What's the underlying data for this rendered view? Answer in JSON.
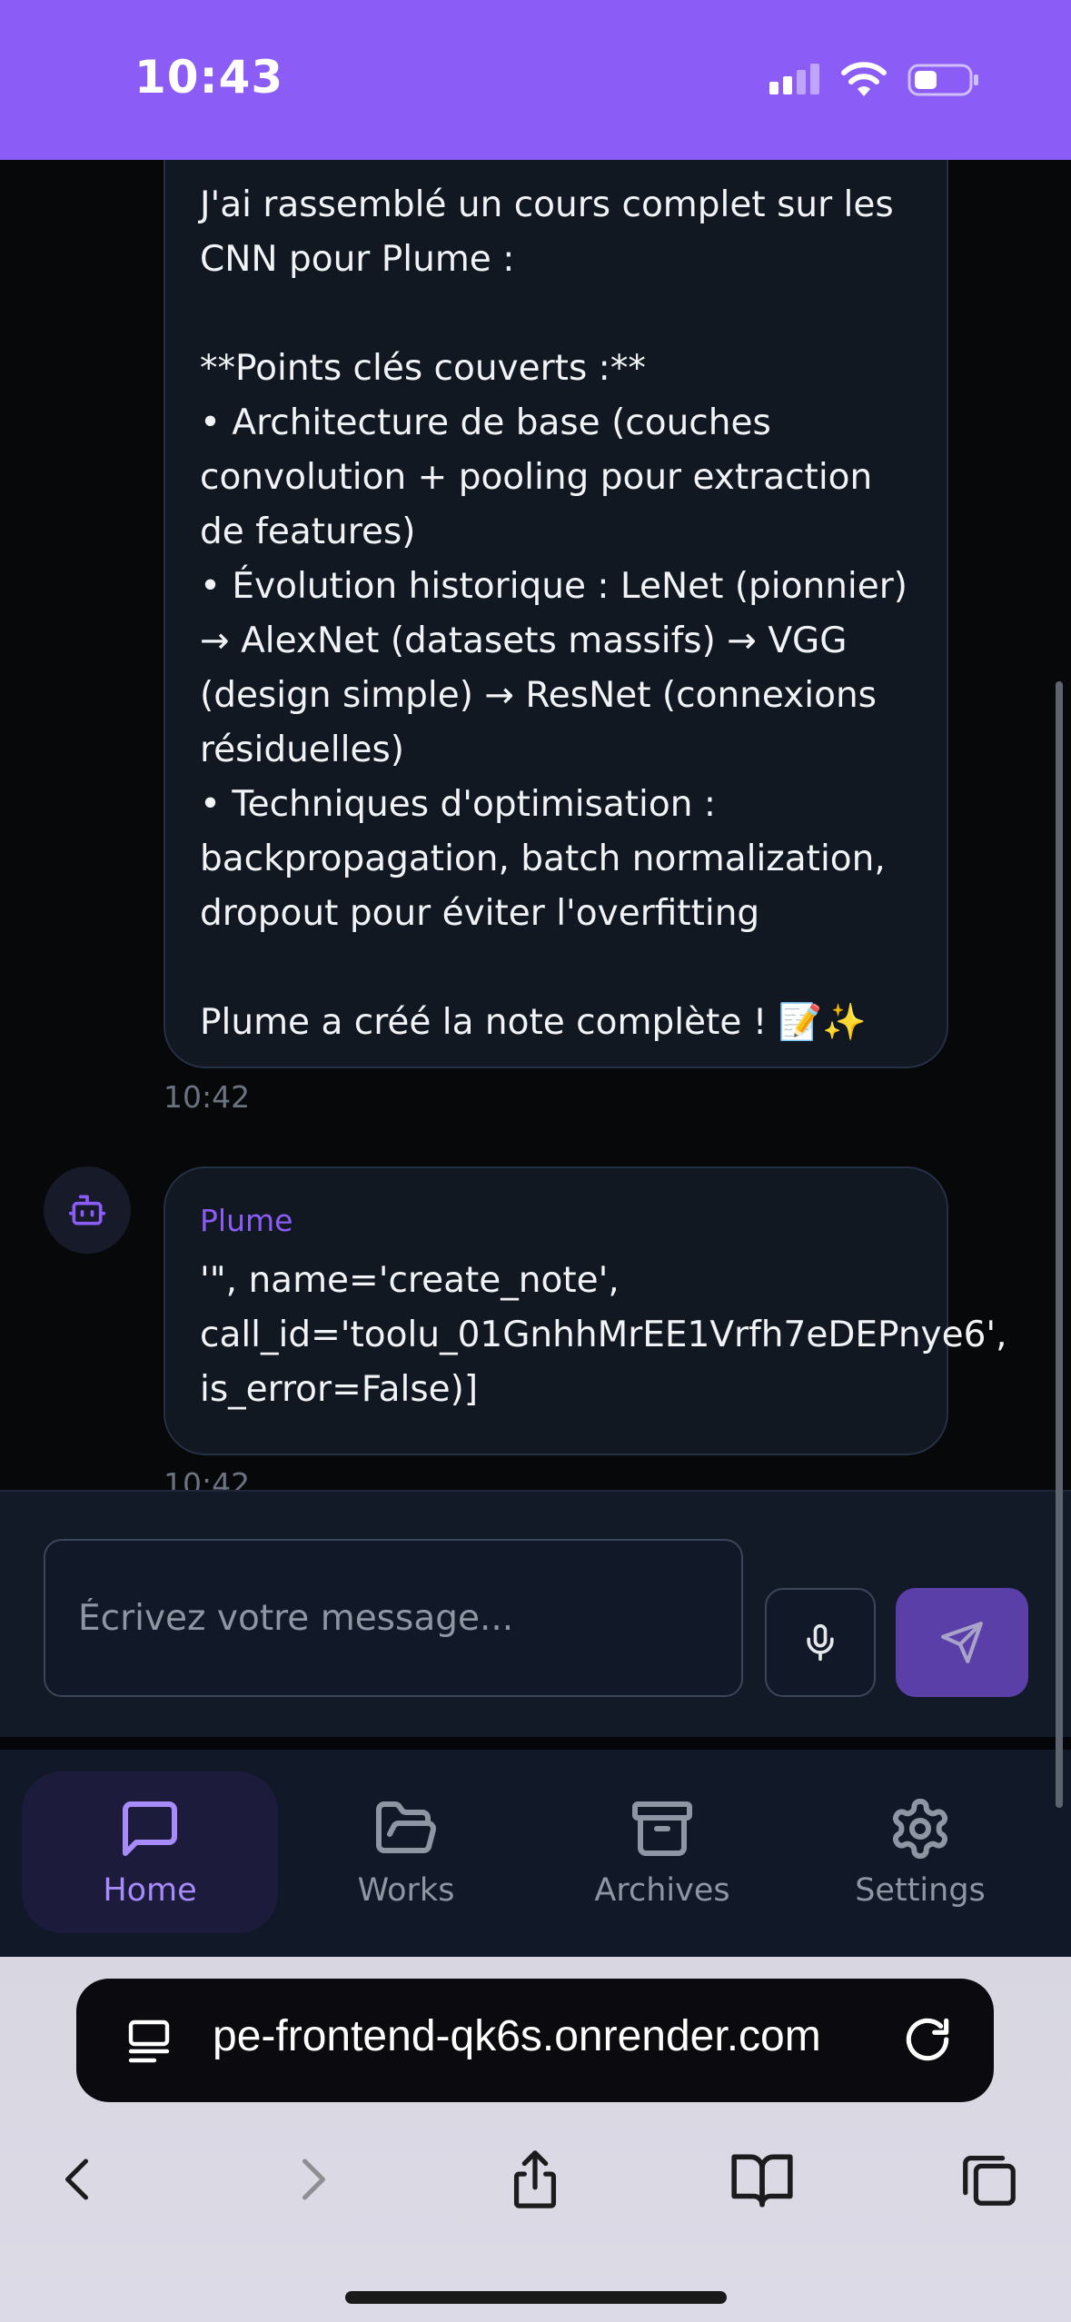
{
  "status_bar": {
    "time": "10:43"
  },
  "chat": {
    "messages": [
      {
        "text": "J'ai rassemblé un cours complet sur les\nCNN pour Plume :\n\n**Points clés couverts :**\n• Architecture de base (couches\nconvolution + pooling pour extraction\nde features)\n• Évolution historique : LeNet (pionnier)\n→ AlexNet (datasets massifs) → VGG\n(design simple) → ResNet (connexions\nrésiduelles)\n• Techniques d'optimisation :\nbackpropagation, batch normalization,\ndropout pour éviter l'overfitting\n\nPlume a créé la note complète ! 📝✨",
        "time": "10:42"
      },
      {
        "sender": "Plume",
        "text": "'\", name='create_note',\ncall_id='toolu_01GnhhMrEE1Vrfh7eDEPnye6',\nis_error=False)]",
        "time": "10:42"
      }
    ]
  },
  "composer": {
    "placeholder": "Écrivez votre message..."
  },
  "nav": {
    "items": [
      {
        "label": "Home",
        "icon": "message-square-icon",
        "active": true
      },
      {
        "label": "Works",
        "icon": "folder-open-icon"
      },
      {
        "label": "Archives",
        "icon": "archive-icon"
      },
      {
        "label": "Settings",
        "icon": "gear-icon"
      }
    ]
  },
  "browser": {
    "url": "pe-frontend-qk6s.onrender.com"
  },
  "colors": {
    "accent": "#8b5cf6",
    "background": "#070809",
    "bubble": "#121821"
  }
}
